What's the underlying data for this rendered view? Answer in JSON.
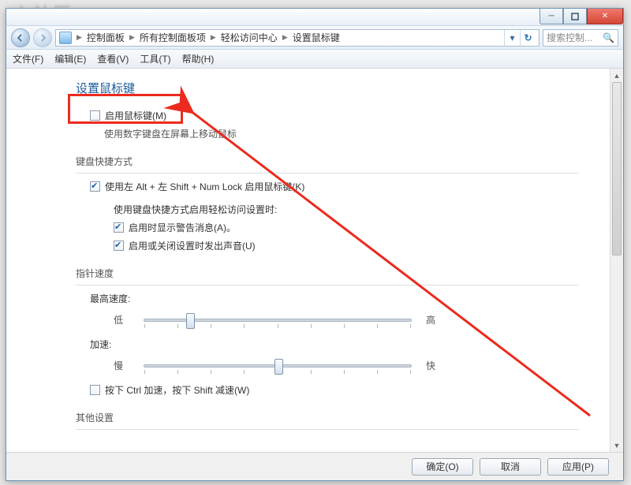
{
  "bg_hint": "小社区",
  "titlebar": {
    "logo_hint": "🔺"
  },
  "breadcrumbs": {
    "items": [
      "控制面板",
      "所有控制面板项",
      "轻松访问中心",
      "设置鼠标键"
    ]
  },
  "search": {
    "placeholder": "搜索控制..."
  },
  "menu": {
    "file": "文件(F)",
    "edit": "编辑(E)",
    "view": "查看(V)",
    "tools": "工具(T)",
    "help": "帮助(H)"
  },
  "page": {
    "heading": "设置鼠标键",
    "enable_mouse_keys": "启用鼠标键(M)",
    "enable_mouse_keys_desc": "使用数字键盘在屏幕上移动鼠标",
    "shortcut_section": "键盘快捷方式",
    "shortcut_toggle": "使用左 Alt + 左 Shift + Num Lock 启用鼠标键(K)",
    "shortcut_when": "使用键盘快捷方式启用轻松访问设置时:",
    "show_warning": "启用时显示警告消息(A)。",
    "make_sound": "启用或关闭设置时发出声音(U)",
    "pointer_speed_section": "指针速度",
    "top_speed": "最高速度:",
    "low": "低",
    "high": "高",
    "accel": "加速:",
    "slow": "慢",
    "fast": "快",
    "ctrl_shift": "按下 Ctrl 加速，按下 Shift 减速(W)",
    "other_section": "其他设置"
  },
  "buttons": {
    "ok": "确定(O)",
    "cancel": "取消",
    "apply": "应用(P)"
  },
  "sliders": {
    "top_speed_pos": 0.16,
    "accel_pos": 0.5
  }
}
